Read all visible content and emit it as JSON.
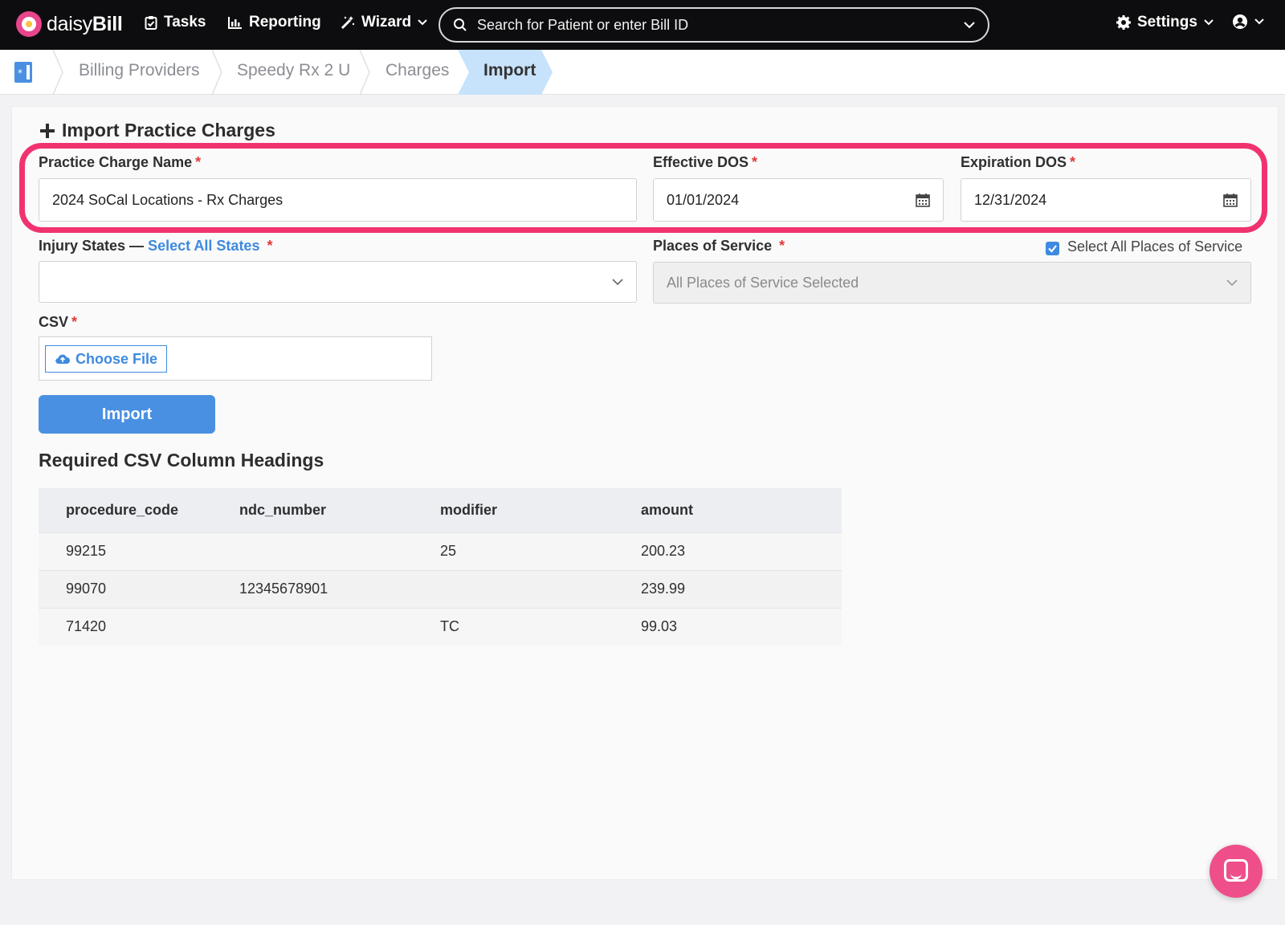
{
  "app": {
    "brand_prefix": "daisy",
    "brand_suffix": "Bill"
  },
  "nav": {
    "tasks": "Tasks",
    "reporting": "Reporting",
    "wizard": "Wizard",
    "settings": "Settings"
  },
  "search": {
    "placeholder": "Search for Patient or enter Bill ID"
  },
  "breadcrumb": {
    "items": [
      "Billing Providers",
      "Speedy Rx 2 U",
      "Charges"
    ],
    "active": "Import"
  },
  "form": {
    "title": "Import Practice Charges",
    "charge_name_label": "Practice Charge Name",
    "charge_name_value": "2024 SoCal Locations - Rx Charges",
    "effective_dos_label": "Effective DOS",
    "effective_dos_value": "01/01/2024",
    "expiration_dos_label": "Expiration DOS",
    "expiration_dos_value": "12/31/2024",
    "injury_states_label": "Injury States —",
    "select_all_states_link": "Select All States",
    "injury_states_value": "",
    "places_label": "Places of Service",
    "select_all_places_label": "Select All Places of Service",
    "select_all_places_checked": true,
    "places_value": "All Places of Service Selected",
    "csv_label": "CSV",
    "choose_file_label": "Choose File",
    "import_button": "Import",
    "required_marker": "*"
  },
  "csv_table": {
    "heading": "Required CSV Column Headings",
    "columns": [
      "procedure_code",
      "ndc_number",
      "modifier",
      "amount"
    ],
    "rows": [
      [
        "99215",
        "",
        "25",
        "200.23"
      ],
      [
        "99070",
        "12345678901",
        "",
        "239.99"
      ],
      [
        "71420",
        "",
        "TC",
        "99.03"
      ]
    ]
  },
  "colors": {
    "accent": "#3d8ae0",
    "highlight": "#f0336f",
    "topbar": "#0d0d0f",
    "chat": "#ee4f8b"
  }
}
